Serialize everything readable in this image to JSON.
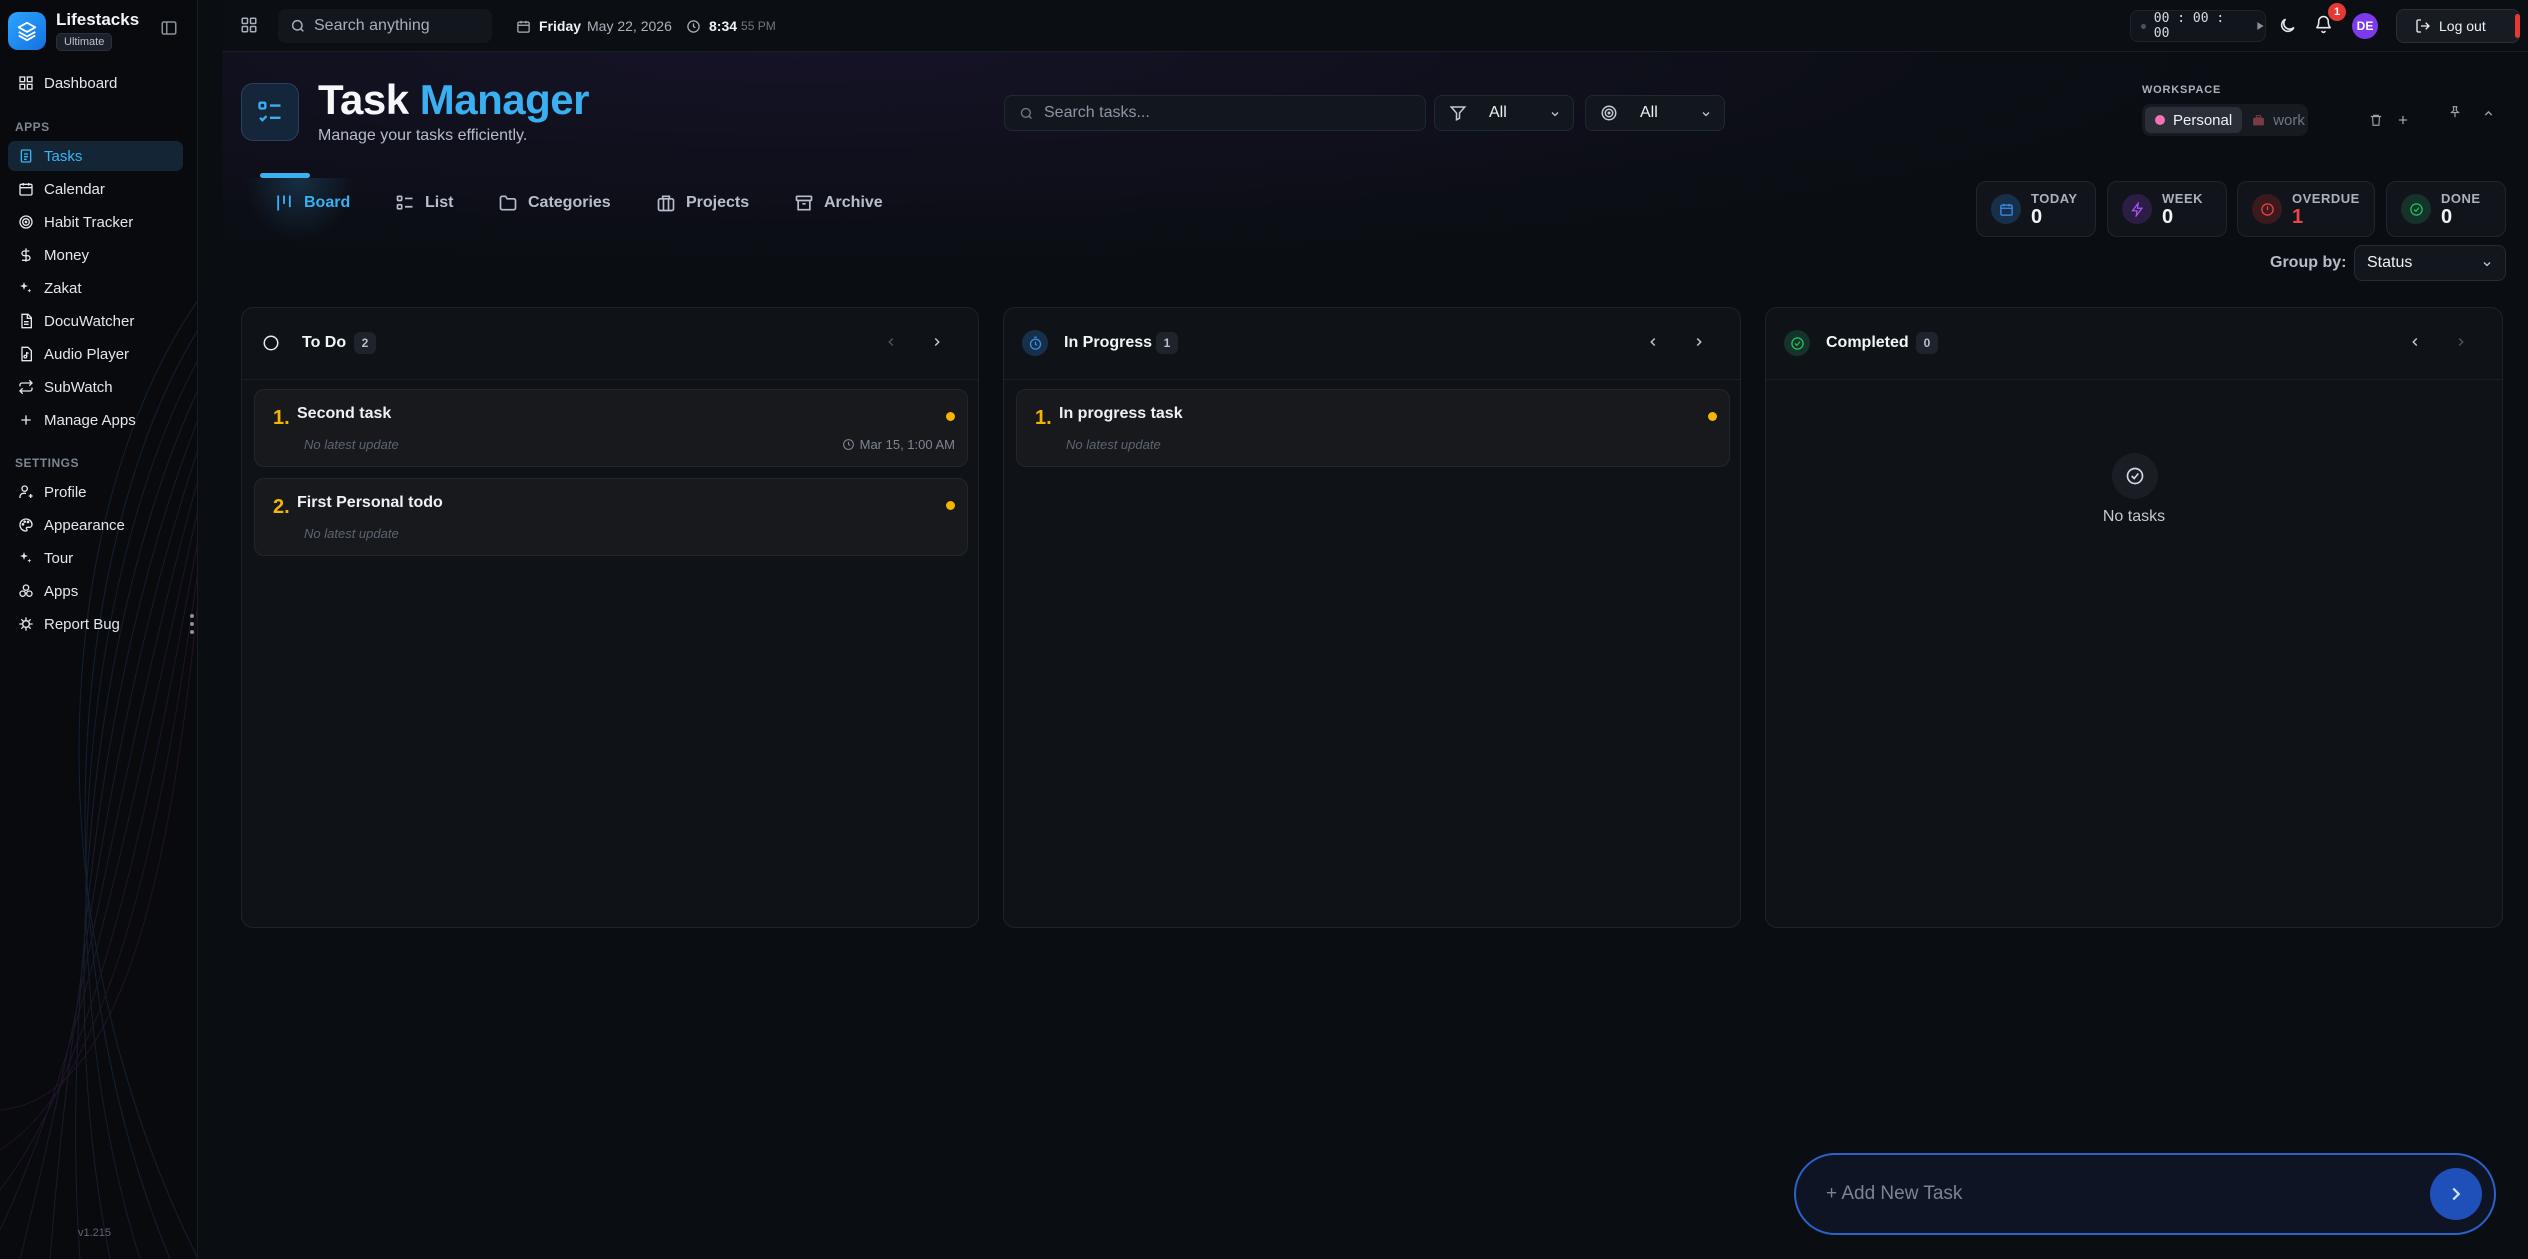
{
  "colors": {
    "accent": "#3bb0f0",
    "priority": "#f4b400",
    "danger": "#e53935",
    "success": "#22c55e",
    "purple": "#a855f7"
  },
  "sidebar": {
    "brand": {
      "name": "Lifestacks",
      "tier": "Ultimate"
    },
    "dashboard": {
      "label": "Dashboard",
      "icon": "dashboard-icon"
    },
    "apps_label": "APPS",
    "apps": [
      {
        "label": "Tasks",
        "icon": "tasks-icon",
        "active": true
      },
      {
        "label": "Calendar",
        "icon": "calendar-icon"
      },
      {
        "label": "Habit Tracker",
        "icon": "target-icon"
      },
      {
        "label": "Money",
        "icon": "dollar-icon"
      },
      {
        "label": "Zakat",
        "icon": "sparkle-icon"
      },
      {
        "label": "DocuWatcher",
        "icon": "document-icon"
      },
      {
        "label": "Audio Player",
        "icon": "audio-icon"
      },
      {
        "label": "SubWatch",
        "icon": "repeat-icon"
      },
      {
        "label": "Manage Apps",
        "icon": "plus-icon"
      }
    ],
    "settings_label": "SETTINGS",
    "settings": [
      {
        "label": "Profile",
        "icon": "user-icon"
      },
      {
        "label": "Appearance",
        "icon": "palette-icon"
      },
      {
        "label": "Tour",
        "icon": "sparkle-icon"
      },
      {
        "label": "Apps",
        "icon": "apps-icon"
      },
      {
        "label": "Report Bug",
        "icon": "bug-icon"
      }
    ],
    "version": "v1.215"
  },
  "topbar": {
    "search_placeholder": "Search anything",
    "date_day": "Friday",
    "date": "May 22, 2026",
    "time": "8:34",
    "time_suffix": "55 PM",
    "timer": "00 : 00 : 00",
    "notifications_count": "1",
    "avatar_initials": "DE",
    "logout_label": "Log out"
  },
  "header": {
    "title_part1": "Task",
    "title_part2": "Manager",
    "subtitle": "Manage your tasks efficiently.",
    "search_placeholder": "Search tasks...",
    "filter_value": "All",
    "priority_filter_value": "All"
  },
  "workspace": {
    "label": "WORKSPACE",
    "options": [
      {
        "label": "Personal",
        "active": true
      },
      {
        "label": "work",
        "active": false
      }
    ]
  },
  "view_tabs": [
    {
      "label": "Board",
      "icon": "board-icon",
      "active": true
    },
    {
      "label": "List",
      "icon": "list-icon"
    },
    {
      "label": "Categories",
      "icon": "folder-icon"
    },
    {
      "label": "Projects",
      "icon": "briefcase-icon"
    },
    {
      "label": "Archive",
      "icon": "archive-icon"
    }
  ],
  "stats": [
    {
      "label": "TODAY",
      "value": "0",
      "icon": "calendar-icon"
    },
    {
      "label": "WEEK",
      "value": "0",
      "icon": "bolt-icon"
    },
    {
      "label": "OVERDUE",
      "value": "1",
      "icon": "alert-icon"
    },
    {
      "label": "DONE",
      "value": "0",
      "icon": "check-circle-icon"
    }
  ],
  "group_by": {
    "label": "Group by:",
    "value": "Status"
  },
  "columns": [
    {
      "title": "To Do",
      "count": "2",
      "tasks": [
        {
          "num": "1.",
          "title": "Second task",
          "sub": "No latest update",
          "date": "Mar 15, 1:00 AM"
        },
        {
          "num": "2.",
          "title": "First Personal todo",
          "sub": "No latest update"
        }
      ]
    },
    {
      "title": "In Progress",
      "count": "1",
      "tasks": [
        {
          "num": "1.",
          "title": "In progress task",
          "sub": "No latest update"
        }
      ]
    },
    {
      "title": "Completed",
      "count": "0",
      "tasks": [],
      "empty_text": "No tasks"
    }
  ],
  "add_task": {
    "placeholder": "+ Add New Task"
  }
}
